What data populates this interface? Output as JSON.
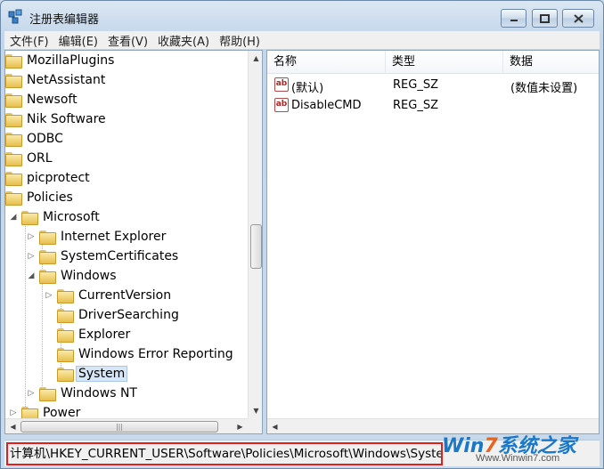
{
  "window": {
    "title": "注册表编辑器",
    "icon": "registry-editor-icon"
  },
  "menu": [
    {
      "label": "文件(F)"
    },
    {
      "label": "编辑(E)"
    },
    {
      "label": "查看(V)"
    },
    {
      "label": "收藏夹(A)"
    },
    {
      "label": "帮助(H)"
    }
  ],
  "tree": {
    "items": [
      {
        "label": "MozillaPlugins"
      },
      {
        "label": "NetAssistant"
      },
      {
        "label": "Newsoft"
      },
      {
        "label": "Nik Software"
      },
      {
        "label": "ODBC"
      },
      {
        "label": "ORL"
      },
      {
        "label": "picprotect"
      },
      {
        "label": "Policies"
      },
      {
        "label": "Microsoft"
      },
      {
        "label": "Internet Explorer"
      },
      {
        "label": "SystemCertificates"
      },
      {
        "label": "Windows"
      },
      {
        "label": "CurrentVersion"
      },
      {
        "label": "DriverSearching"
      },
      {
        "label": "Explorer"
      },
      {
        "label": "Windows Error Reporting"
      },
      {
        "label": "System",
        "selected": true
      },
      {
        "label": "Windows NT"
      },
      {
        "label": "Power"
      }
    ]
  },
  "list": {
    "columns": [
      "名称",
      "类型",
      "数据"
    ],
    "rows": [
      {
        "name": "(默认)",
        "type": "REG_SZ",
        "data": "(数值未设置)",
        "icon": "string-value-icon"
      },
      {
        "name": "DisableCMD",
        "type": "REG_SZ",
        "data": "",
        "icon": "string-value-icon"
      }
    ]
  },
  "status": {
    "path": "计算机\\HKEY_CURRENT_USER\\Software\\Policies\\Microsoft\\Windows\\System"
  },
  "watermark": {
    "logo_prefix": "Win",
    "logo_seven": "7",
    "logo_suffix": "系统之家",
    "url": "Www.Winwin7.com"
  },
  "colors": {
    "highlight_border": "#e02020",
    "selection": "#d6e6f6"
  }
}
